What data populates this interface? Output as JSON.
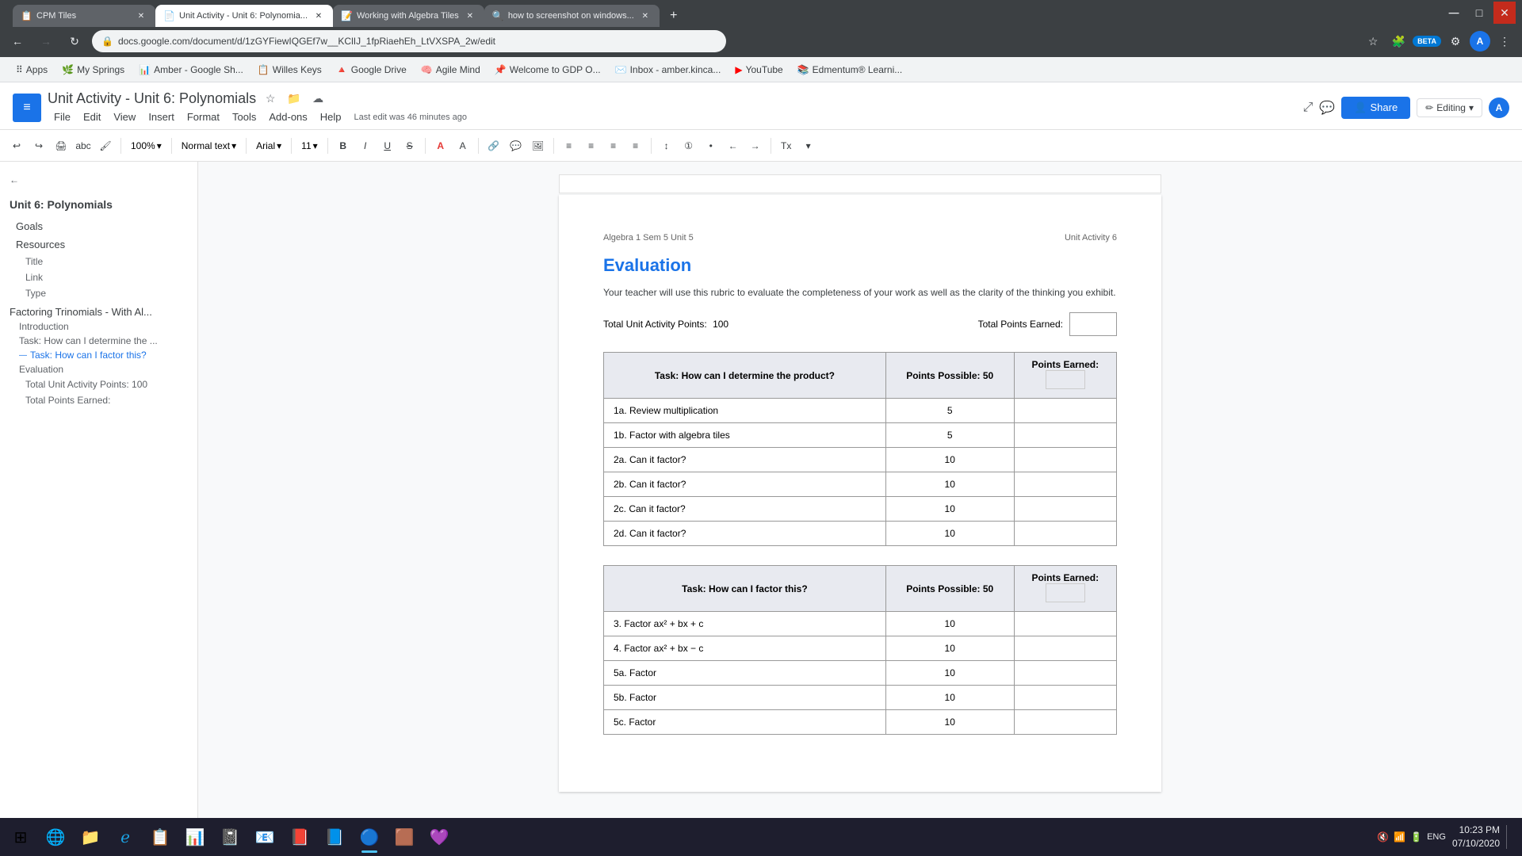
{
  "browser": {
    "tabs": [
      {
        "id": "cpm-tiles",
        "title": "CPM Tiles",
        "favicon": "📋",
        "active": false
      },
      {
        "id": "unit-activity",
        "title": "Unit Activity - Unit 6: Polynomia...",
        "favicon": "📄",
        "active": true
      },
      {
        "id": "algebra-tiles",
        "title": "Working with Algebra Tiles",
        "favicon": "📝",
        "active": false
      },
      {
        "id": "screenshot",
        "title": "how to screenshot on windows...",
        "favicon": "🔍",
        "active": false
      }
    ],
    "address": "docs.google.com/document/d/1zGYFiewIQGEf7w__KClIJ_1fpRiaehEh_LtVXSPA_2w/edit",
    "nav": {
      "back_disabled": false,
      "forward_disabled": true
    }
  },
  "bookmarks": [
    {
      "id": "apps",
      "label": "Apps",
      "icon": "⠿"
    },
    {
      "id": "my-springs",
      "label": "My Springs",
      "icon": "🌿"
    },
    {
      "id": "amber-google",
      "label": "Amber - Google Sh...",
      "icon": "📊"
    },
    {
      "id": "willes-keys",
      "label": "Willes Keys",
      "icon": "📋"
    },
    {
      "id": "google-drive",
      "label": "Google Drive",
      "icon": "🔺"
    },
    {
      "id": "agile-mind",
      "label": "Agile Mind",
      "icon": "🧠"
    },
    {
      "id": "welcome-gdp",
      "label": "Welcome to GDP O...",
      "icon": "📌"
    },
    {
      "id": "inbox",
      "label": "Inbox - amber.kinca...",
      "icon": "✉️"
    },
    {
      "id": "youtube",
      "label": "YouTube",
      "icon": "▶"
    },
    {
      "id": "edmentum",
      "label": "Edmentum® Learni...",
      "icon": "📚"
    }
  ],
  "docs": {
    "icon": "📄",
    "title": "Unit Activity - Unit 6: Polynomials",
    "last_edit": "Last edit was 46 minutes ago",
    "menu_items": [
      "File",
      "Edit",
      "View",
      "Insert",
      "Format",
      "Tools",
      "Add-ons",
      "Help"
    ],
    "share_label": "Share",
    "editing_label": "Editing",
    "toolbar": {
      "undo": "↩",
      "redo": "↪",
      "print": "🖨",
      "paint_format": "🖌",
      "zoom": "100%",
      "style": "Normal text",
      "font": "Arial",
      "size": "11",
      "bold": "B",
      "italic": "I",
      "underline": "U",
      "strikethrough": "S",
      "text_color": "A",
      "highlight": "A",
      "link": "🔗",
      "comment": "💬",
      "image": "🖼",
      "align": "≡",
      "line_spacing": "↕",
      "list_numbered": "①",
      "list_bullet": "•",
      "decrease_indent": "←",
      "increase_indent": "→",
      "clear_format": "Tx"
    }
  },
  "sidebar": {
    "unit_title": "Unit 6: Polynomials",
    "sections": [
      {
        "id": "goals",
        "label": "Goals",
        "indent": 1
      },
      {
        "id": "resources",
        "label": "Resources",
        "indent": 1
      },
      {
        "id": "title",
        "label": "Title",
        "indent": 2
      },
      {
        "id": "link",
        "label": "Link",
        "indent": 2
      },
      {
        "id": "type",
        "label": "Type",
        "indent": 2
      },
      {
        "id": "factoring",
        "label": "Factoring Trinomials - With Al...",
        "indent": 0,
        "heading": true
      },
      {
        "id": "introduction",
        "label": "Introduction",
        "indent": 1
      },
      {
        "id": "task-determine",
        "label": "Task: How can I determine the ...",
        "indent": 1
      },
      {
        "id": "task-factor",
        "label": "Task: How can I factor this?",
        "indent": 1,
        "active": true
      },
      {
        "id": "evaluation",
        "label": "Evaluation",
        "indent": 1
      },
      {
        "id": "total-activity",
        "label": "Total Unit Activity Points: 100",
        "indent": 2
      },
      {
        "id": "total-earned",
        "label": "Total Points Earned:",
        "indent": 2
      }
    ]
  },
  "document": {
    "header_left": "Algebra 1 Sem 5 Unit 5",
    "header_right": "Unit Activity   6",
    "title": "Evaluation",
    "subtitle": "Your teacher will use this rubric to evaluate the completeness of your work as well as the clarity of the thinking you exhibit.",
    "total_points_label": "Total Unit Activity Points:",
    "total_points_value": "100",
    "total_earned_label": "Total Points Earned:",
    "table1": {
      "task_header": "Task: How can I determine the product?",
      "points_possible_header": "Points Possible:  50",
      "points_earned_header": "Points Earned:",
      "rows": [
        {
          "label": "1a.  Review multiplication",
          "points": "5"
        },
        {
          "label": "1b.  Factor with algebra tiles",
          "points": "5"
        },
        {
          "label": "2a.  Can it factor?",
          "points": "10"
        },
        {
          "label": "2b.  Can it factor?",
          "points": "10"
        },
        {
          "label": "2c.  Can it factor?",
          "points": "10"
        },
        {
          "label": "2d.  Can it factor?",
          "points": "10"
        }
      ]
    },
    "table2": {
      "task_header": "Task: How can I factor this?",
      "points_possible_header": "Points Possible:  50",
      "points_earned_header": "Points Earned:",
      "rows": [
        {
          "label": "3.  Factor  ax² + bx + c",
          "points": "10"
        },
        {
          "label": "4.  Factor  ax² + bx − c",
          "points": "10"
        },
        {
          "label": "5a.  Factor",
          "points": "10"
        },
        {
          "label": "5b.  Factor",
          "points": "10"
        },
        {
          "label": "5c.  Factor",
          "points": "10"
        }
      ]
    }
  },
  "taskbar": {
    "apps": [
      {
        "id": "windows",
        "icon": "⊞",
        "label": "Start"
      },
      {
        "id": "edge",
        "icon": "🌐",
        "label": "Edge"
      },
      {
        "id": "explorer",
        "icon": "📁",
        "label": "File Explorer"
      },
      {
        "id": "cpm",
        "icon": "📋",
        "label": "CPM"
      },
      {
        "id": "excel",
        "icon": "📊",
        "label": "Excel"
      },
      {
        "id": "onenote",
        "icon": "📓",
        "label": "OneNote"
      },
      {
        "id": "outlook",
        "icon": "📧",
        "label": "Outlook"
      },
      {
        "id": "powerpoint",
        "icon": "📕",
        "label": "PowerPoint"
      },
      {
        "id": "word",
        "icon": "📘",
        "label": "Word"
      },
      {
        "id": "chrome",
        "icon": "🔵",
        "label": "Chrome",
        "active": true
      },
      {
        "id": "minecraft",
        "icon": "🟫",
        "label": "Minecraft"
      },
      {
        "id": "twitch",
        "icon": "💜",
        "label": "Twitch"
      }
    ],
    "time": "10:23 PM",
    "date": "07/10/2020",
    "sys_icons": [
      "🔇",
      "📶",
      "🔋"
    ]
  }
}
